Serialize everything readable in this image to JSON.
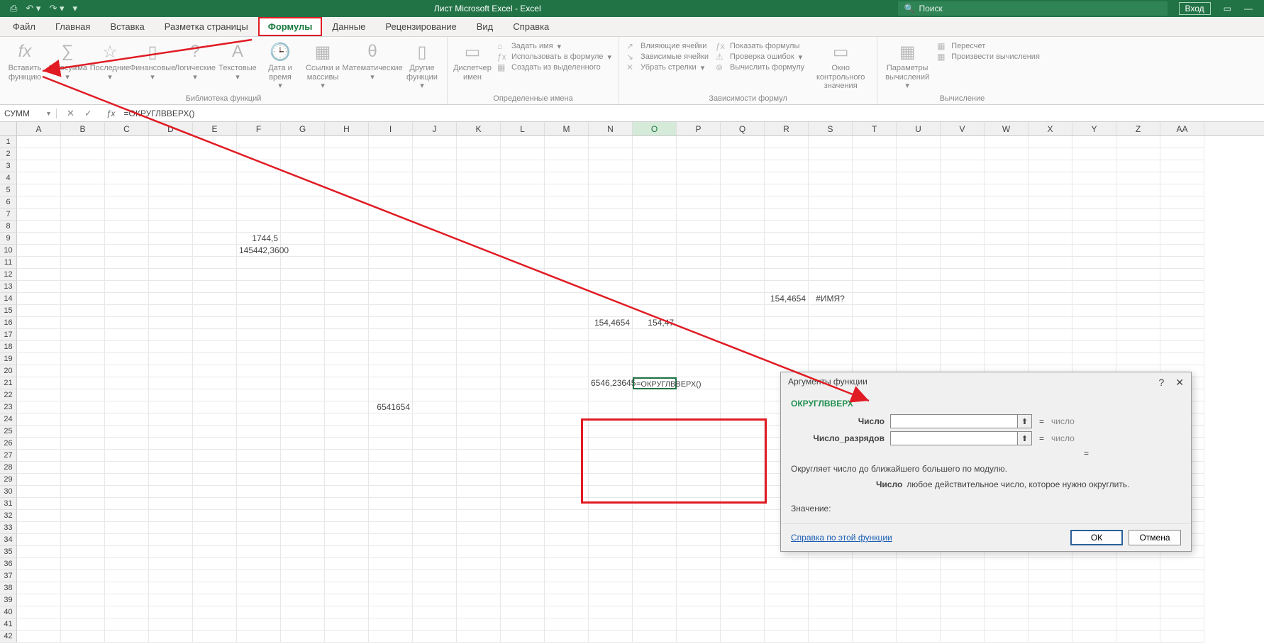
{
  "title": "Лист Microsoft Excel  -  Excel",
  "search_placeholder": "Поиск",
  "login_label": "Вход",
  "menu_tabs": [
    "Файл",
    "Главная",
    "Вставка",
    "Разметка страницы",
    "Формулы",
    "Данные",
    "Рецензирование",
    "Вид",
    "Справка"
  ],
  "active_tab_index": 4,
  "ribbon": {
    "group1_label": "Библиотека функций",
    "g1": {
      "insert_fn": "Вставить функцию",
      "autosum": "Автосумма",
      "recent": "Последние",
      "financial": "Финансовые",
      "logical": "Логические",
      "text": "Текстовые",
      "datetime": "Дата и время",
      "lookup": "Ссылки и массивы",
      "math": "Математические",
      "other": "Другие функции"
    },
    "group2_label": "Определенные имена",
    "g2": {
      "name_mgr": "Диспетчер имен",
      "define_name": "Задать имя",
      "use_in_formula": "Использовать в формуле",
      "create_from_sel": "Создать из выделенного"
    },
    "group3_label": "Зависимости формул",
    "g3": {
      "trace_prec": "Влияющие ячейки",
      "trace_dep": "Зависимые ячейки",
      "remove_arrows": "Убрать стрелки",
      "show_formulas": "Показать формулы",
      "error_check": "Проверка ошибок",
      "eval_formula": "Вычислить формулу",
      "watch": "Окно контрольного значения"
    },
    "group4_label": "Вычисление",
    "g4": {
      "calc_opts": "Параметры вычислений",
      "recalc": "Пересчет",
      "calc_now": "Произвести вычисления"
    }
  },
  "formula_bar": {
    "name_box": "СУММ",
    "formula": "=ОКРУГЛВВЕРХ()"
  },
  "columns": [
    "A",
    "B",
    "C",
    "D",
    "E",
    "F",
    "G",
    "H",
    "I",
    "J",
    "K",
    "L",
    "M",
    "N",
    "O",
    "P",
    "Q",
    "R",
    "S",
    "T",
    "U",
    "V",
    "W",
    "X",
    "Y",
    "Z",
    "AA"
  ],
  "cells": {
    "F9": "1744,5",
    "F10": "145442,3600",
    "R14": "154,4654",
    "S14": "#ИМЯ?",
    "N16": "154,4654",
    "O16": "154,47",
    "N21": "6546,23645",
    "O21": "=ОКРУГЛВВЕРХ()",
    "I23": "6541654"
  },
  "dialog": {
    "title": "Аргументы функции",
    "fn_name": "ОКРУГЛВВЕРХ",
    "param1_label": "Число",
    "param2_label": "Число_разрядов",
    "result_type": "число",
    "eq_placeholder": "=",
    "description": "Округляет число до ближайшего большего по модулю.",
    "param_name": "Число",
    "param_desc": "любое действительное число, которое нужно округлить.",
    "value_label": "Значение:",
    "help_link": "Справка по этой функции",
    "ok": "ОК",
    "cancel": "Отмена"
  }
}
